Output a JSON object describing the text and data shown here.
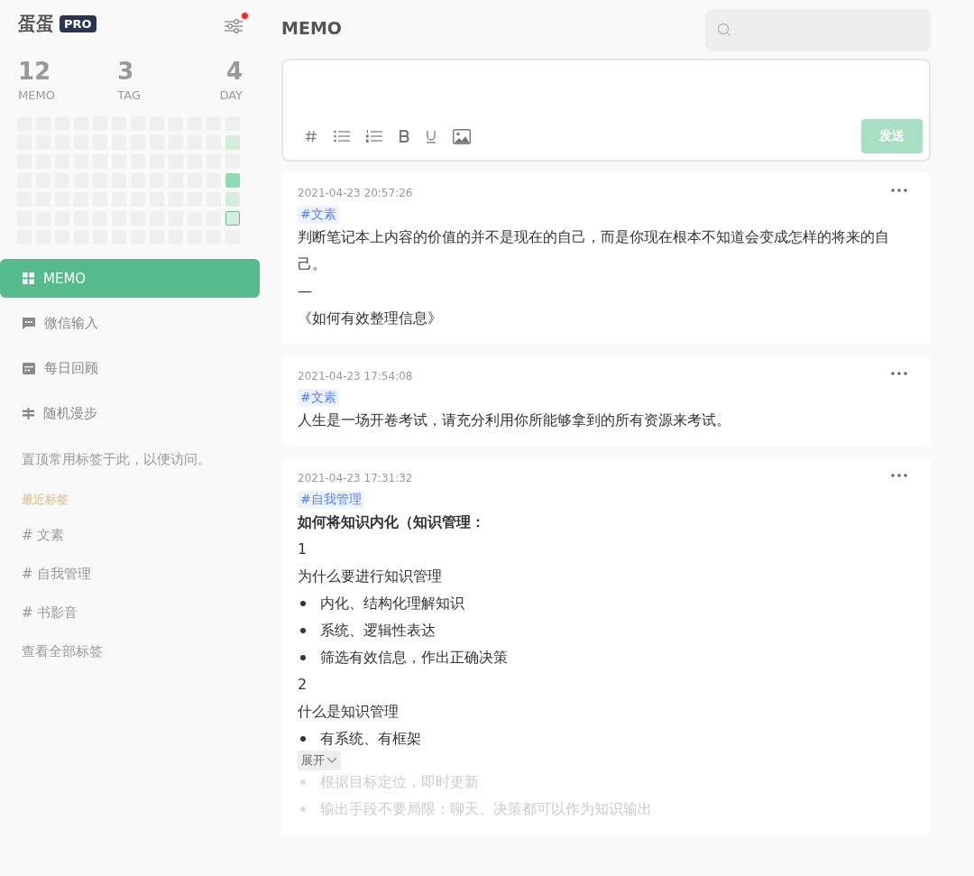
{
  "brand": {
    "name": "蛋蛋",
    "badge": "PRO",
    "settings_notification": true
  },
  "stats": [
    {
      "value": "12",
      "label": "MEMO"
    },
    {
      "value": "3",
      "label": "TAG"
    },
    {
      "value": "4",
      "label": "DAY"
    }
  ],
  "heatmap": [
    [
      {
        "color": "#efefef"
      },
      {
        "color": "#efefef"
      },
      {
        "color": "#efefef"
      },
      {
        "color": "#efefef"
      },
      {
        "color": "#efefef"
      },
      {
        "color": "#efefef"
      },
      {
        "color": "#efefef"
      },
      {
        "color": "#efefef"
      },
      {
        "color": "#efefef"
      },
      {
        "color": "#efefef"
      },
      {
        "color": "#efefef"
      },
      {
        "color": "#efefef"
      }
    ],
    [
      {
        "color": "#efefef"
      },
      {
        "color": "#efefef"
      },
      {
        "color": "#efefef"
      },
      {
        "color": "#efefef"
      },
      {
        "color": "#efefef"
      },
      {
        "color": "#efefef"
      },
      {
        "color": "#efefef"
      },
      {
        "color": "#efefef"
      },
      {
        "color": "#efefef"
      },
      {
        "color": "#efefef"
      },
      {
        "color": "#efefef"
      },
      {
        "color": "#d4eddf"
      }
    ],
    [
      {
        "color": "#efefef"
      },
      {
        "color": "#efefef"
      },
      {
        "color": "#efefef"
      },
      {
        "color": "#efefef"
      },
      {
        "color": "#efefef"
      },
      {
        "color": "#efefef"
      },
      {
        "color": "#efefef"
      },
      {
        "color": "#efefef"
      },
      {
        "color": "#efefef"
      },
      {
        "color": "#efefef"
      },
      {
        "color": "#efefef"
      },
      {
        "color": "#efefef"
      }
    ],
    [
      {
        "color": "#efefef"
      },
      {
        "color": "#efefef"
      },
      {
        "color": "#efefef"
      },
      {
        "color": "#efefef"
      },
      {
        "color": "#efefef"
      },
      {
        "color": "#efefef"
      },
      {
        "color": "#efefef"
      },
      {
        "color": "#efefef"
      },
      {
        "color": "#efefef"
      },
      {
        "color": "#efefef"
      },
      {
        "color": "#efefef"
      },
      {
        "color": "#8edcb4"
      }
    ],
    [
      {
        "color": "#efefef"
      },
      {
        "color": "#efefef"
      },
      {
        "color": "#efefef"
      },
      {
        "color": "#efefef"
      },
      {
        "color": "#efefef"
      },
      {
        "color": "#efefef"
      },
      {
        "color": "#efefef"
      },
      {
        "color": "#efefef"
      },
      {
        "color": "#efefef"
      },
      {
        "color": "#efefef"
      },
      {
        "color": "#efefef"
      },
      {
        "color": "#d4eddf"
      }
    ],
    [
      {
        "color": "#efefef"
      },
      {
        "color": "#efefef"
      },
      {
        "color": "#efefef"
      },
      {
        "color": "#efefef"
      },
      {
        "color": "#efefef"
      },
      {
        "color": "#efefef"
      },
      {
        "color": "#efefef"
      },
      {
        "color": "#efefef"
      },
      {
        "color": "#efefef"
      },
      {
        "color": "#efefef"
      },
      {
        "color": "#efefef"
      },
      {
        "color": "#d4eddf",
        "today": true
      }
    ],
    [
      {
        "color": "#efefef"
      },
      {
        "color": "#efefef"
      },
      {
        "color": "#efefef"
      },
      {
        "color": "#efefef"
      },
      {
        "color": "#efefef"
      },
      {
        "color": "#efefef"
      },
      {
        "color": "#efefef"
      },
      {
        "color": "#efefef"
      },
      {
        "color": "#efefef"
      },
      {
        "color": "#efefef"
      },
      {
        "color": "#efefef"
      },
      {
        "color": "#efefef"
      }
    ]
  ],
  "nav": [
    {
      "label": "MEMO",
      "kind": "grid",
      "selected": true
    },
    {
      "label": "微信输入",
      "kind": "chat",
      "selected": false
    },
    {
      "label": "每日回顾",
      "kind": "calendar",
      "selected": false
    },
    {
      "label": "随机漫步",
      "kind": "signpost",
      "selected": false
    }
  ],
  "pin_hint": "置顶常用标签于此，以便访问。",
  "recent_tags_title": "最近标签",
  "recent_tags": [
    "# 文素",
    "# 自我管理",
    "# 书影音"
  ],
  "view_all_tags": "查看全部标签",
  "page_title": "MEMO",
  "editor": {
    "tools": [
      {
        "kind": "hash"
      },
      {
        "kind": "bullets"
      },
      {
        "kind": "numbers"
      },
      {
        "kind": "bold"
      },
      {
        "kind": "underline"
      },
      {
        "kind": "image"
      }
    ],
    "send": "发送",
    "send_disabled": true
  },
  "memos": [
    {
      "time": "2021-04-23 20:57:26",
      "tag": "#文素",
      "lines": [
        {
          "kind": "text",
          "text": "判断笔记本上内容的价值的并不是现在的自己，而是你现在根本不知道会变成怎样的将来的自己。"
        },
        {
          "kind": "text",
          "text": "—"
        },
        {
          "kind": "text",
          "text": "《如何有效整理信息》"
        }
      ]
    },
    {
      "time": "2021-04-23 17:54:08",
      "tag": "#文素",
      "lines": [
        {
          "kind": "text",
          "text": "人生是一场开卷考试，请充分利用你所能够拿到的所有资源来考试。"
        }
      ]
    },
    {
      "time": "2021-04-23 17:31:32",
      "tag": "#自我管理",
      "collapsed": true,
      "expand": "展开",
      "lines": [
        {
          "kind": "bold",
          "text": "如何将知识内化（知识管理："
        },
        {
          "kind": "text",
          "text": "1"
        },
        {
          "kind": "text",
          "text": "为什么要进行知识管理"
        },
        {
          "kind": "bullet",
          "text": "内化、结构化理解知识"
        },
        {
          "kind": "bullet",
          "text": "系统、逻辑性表达"
        },
        {
          "kind": "bullet",
          "text": "筛选有效信息，作出正确决策"
        },
        {
          "kind": "text",
          "text": "2"
        },
        {
          "kind": "text",
          "text": "什么是知识管理"
        },
        {
          "kind": "bullet",
          "text": "有系统、有框架"
        },
        {
          "kind": "bullet",
          "text": "根据目标定位，即时更新",
          "faded": true
        },
        {
          "kind": "bullet",
          "text": "输出手段不要局限：聊天、决策都可以作为知识输出",
          "faded": true
        }
      ]
    }
  ]
}
